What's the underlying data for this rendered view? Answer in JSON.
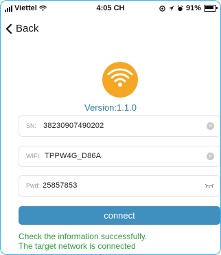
{
  "status_bar": {
    "carrier": "Viettel",
    "time": "4:05 CH",
    "battery": "91%",
    "icons": [
      "signal-icon",
      "wifi-icon",
      "location-icon",
      "alarm-icon",
      "battery-icon"
    ]
  },
  "nav": {
    "back_label": "Back"
  },
  "app": {
    "version": "Version:1.1.0"
  },
  "fields": {
    "sn": {
      "label": "SN:",
      "value": "38230907490202"
    },
    "wifi": {
      "label": "WIFI:",
      "value": "TPPW4G_D86A"
    },
    "pwd": {
      "label": "Pwd:",
      "value": "25857853"
    }
  },
  "connect_label": "connect",
  "messages": {
    "line1": "Check the information successfully.",
    "line2": "The target network is connected"
  },
  "colors": {
    "accent_blue": "#3f8fbf",
    "logo_orange": "#f5a623",
    "success_green": "#2e9d3a",
    "version_blue": "#2a7ab0"
  }
}
